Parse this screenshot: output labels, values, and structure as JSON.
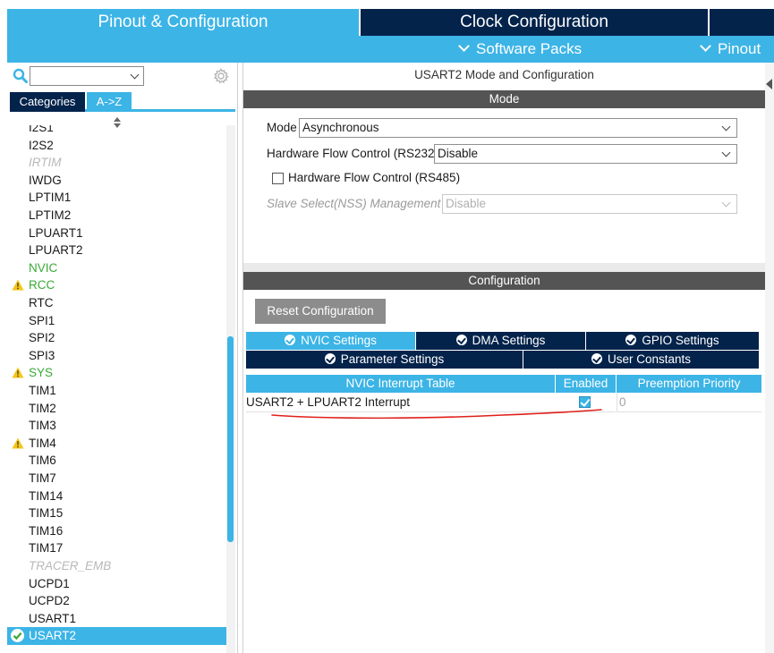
{
  "tabs": {
    "pinout": "Pinout & Configuration",
    "clock": "Clock Configuration"
  },
  "menu": {
    "software_packs": "Software Packs",
    "pinout": "Pinout"
  },
  "left": {
    "search_value": "",
    "category_tabs": [
      "Categories",
      "A->Z"
    ],
    "active_category_tab": "A->Z",
    "items": [
      {
        "label": "I2S1",
        "state": "normal",
        "partial": true
      },
      {
        "label": "I2S2",
        "state": "normal"
      },
      {
        "label": "IRTIM",
        "state": "disabled"
      },
      {
        "label": "IWDG",
        "state": "normal"
      },
      {
        "label": "LPTIM1",
        "state": "normal"
      },
      {
        "label": "LPTIM2",
        "state": "normal"
      },
      {
        "label": "LPUART1",
        "state": "normal"
      },
      {
        "label": "LPUART2",
        "state": "normal"
      },
      {
        "label": "NVIC",
        "state": "green"
      },
      {
        "label": "RCC",
        "state": "warning"
      },
      {
        "label": "RTC",
        "state": "normal"
      },
      {
        "label": "SPI1",
        "state": "normal"
      },
      {
        "label": "SPI2",
        "state": "normal"
      },
      {
        "label": "SPI3",
        "state": "normal"
      },
      {
        "label": "SYS",
        "state": "warning"
      },
      {
        "label": "TIM1",
        "state": "normal"
      },
      {
        "label": "TIM2",
        "state": "normal"
      },
      {
        "label": "TIM3",
        "state": "normal"
      },
      {
        "label": "TIM4",
        "state": "warning-black"
      },
      {
        "label": "TIM6",
        "state": "normal"
      },
      {
        "label": "TIM7",
        "state": "normal"
      },
      {
        "label": "TIM14",
        "state": "normal"
      },
      {
        "label": "TIM15",
        "state": "normal"
      },
      {
        "label": "TIM16",
        "state": "normal"
      },
      {
        "label": "TIM17",
        "state": "normal"
      },
      {
        "label": "TRACER_EMB",
        "state": "disabled"
      },
      {
        "label": "UCPD1",
        "state": "normal"
      },
      {
        "label": "UCPD2",
        "state": "normal"
      },
      {
        "label": "USART1",
        "state": "normal"
      },
      {
        "label": "USART2",
        "state": "selected"
      }
    ]
  },
  "mode": {
    "title": "USART2 Mode and Configuration",
    "section": "Mode",
    "mode_label": "Mode",
    "mode_value": "Asynchronous",
    "hfc232_label": "Hardware Flow Control (RS232)",
    "hfc232_value": "Disable",
    "hfc485_label": "Hardware Flow Control (RS485)",
    "hfc485_checked": false,
    "nss_label": "Slave Select(NSS) Management",
    "nss_value": "Disable"
  },
  "configuration": {
    "section": "Configuration",
    "reset_button": "Reset Configuration",
    "tabs_row1": [
      "NVIC Settings",
      "DMA Settings",
      "GPIO Settings"
    ],
    "tabs_row2": [
      "Parameter Settings",
      "User Constants"
    ],
    "active_tab": "NVIC Settings",
    "table": {
      "headers": [
        "NVIC Interrupt Table",
        "Enabled",
        "Preemption Priority"
      ],
      "rows": [
        {
          "name": "USART2 + LPUART2 Interrupt",
          "enabled": true,
          "priority": "0"
        }
      ]
    }
  },
  "colors": {
    "accent": "#3cb4e6",
    "dark": "#03234b",
    "section_bar": "#545454",
    "green_item": "#3aaa35",
    "warning": "#f5c518",
    "annotation": "#e0201b"
  }
}
